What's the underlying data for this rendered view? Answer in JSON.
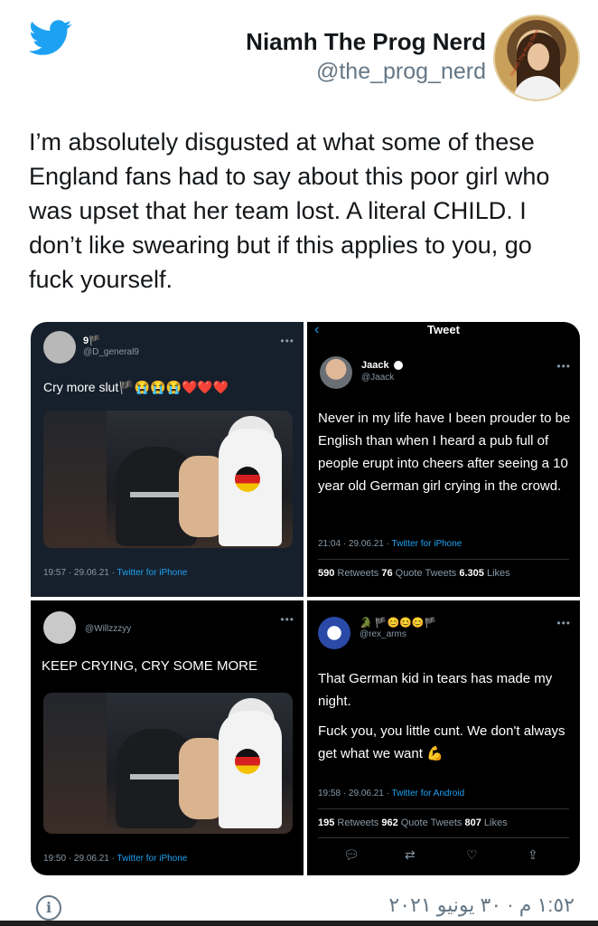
{
  "author": {
    "name": "Niamh The Prog Nerd",
    "handle": "@the_prog_nerd",
    "avatar_text": "Niamh The Prog Nerd"
  },
  "tweet_text": "I’m absolutely disgusted at what some of these England fans had to say about this poor girl who was upset that her team lost. A literal CHILD. I don’t like swearing but if this applies to you, go fuck yourself.",
  "collage": {
    "panel1": {
      "name": "9🏴",
      "handle": "@D_general9",
      "text": "Cry more slut🏴😭😭😭❤️❤️❤️",
      "meta_time": "19:57 · 29.06.21 · ",
      "meta_source": "Twitter for iPhone"
    },
    "panel2": {
      "header": "Tweet",
      "name": "Jaack",
      "handle": "@Jaack",
      "text": "Never in my life have I been prouder to be English than when I heard a pub full of people erupt into cheers after seeing a 10 year old German girl crying in the crowd.",
      "meta_time": "21:04 · 29.06.21 · ",
      "meta_source": "Twitter for iPhone",
      "retweets": "590",
      "retweets_label": " Retweets ",
      "quotes": "76",
      "quotes_label": " Quote Tweets ",
      "likes": "6.305",
      "likes_label": " Likes"
    },
    "panel3": {
      "handle": "@Willzzzyy",
      "text": "KEEP CRYING, CRY SOME MORE",
      "meta_time": "19:50 · 29.06.21 · ",
      "meta_source": "Twitter for iPhone"
    },
    "panel4": {
      "name": "🐊 🏴😊😊😊🏴",
      "handle": "@rex_arms",
      "text1": "That German kid in tears has made my night.",
      "text2": "Fuck you, you little cunt.  We don't always get what we want 💪",
      "meta_time": "19:58 · 29.06.21 · ",
      "meta_source": "Twitter for Android",
      "retweets": "195",
      "retweets_label": " Retweets ",
      "quotes": "962",
      "quotes_label": " Quote Tweets ",
      "likes": "807",
      "likes_label": " Likes"
    }
  },
  "footer": {
    "timestamp": "١:٥٢ م · ٣٠ يونيو ٢٠٢١",
    "info_glyph": "i"
  },
  "colors": {
    "brand": "#1da1f2",
    "text": "#14171a",
    "muted": "#657786"
  },
  "icons": [
    "twitter-bird-icon",
    "info-icon",
    "reply-icon",
    "retweet-icon",
    "like-icon",
    "share-icon",
    "verified-icon",
    "back-chevron-icon"
  ]
}
